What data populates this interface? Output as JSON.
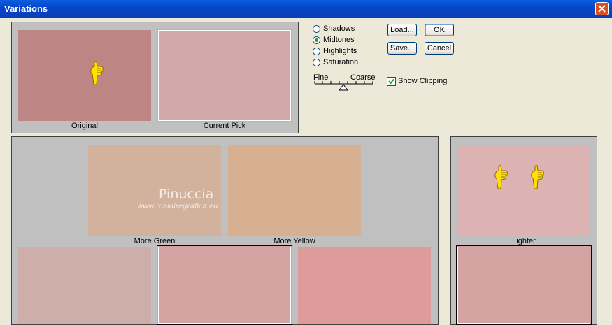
{
  "window": {
    "title": "Variations"
  },
  "preview": {
    "original_label": "Original",
    "current_label": "Current Pick"
  },
  "options": {
    "shadows": "Shadows",
    "midtones": "Midtones",
    "highlights": "Highlights",
    "saturation": "Saturation",
    "selected": "Midtones"
  },
  "slider": {
    "fine": "Fine",
    "coarse": "Coarse"
  },
  "buttons": {
    "load": "Load...",
    "ok": "OK",
    "save": "Save...",
    "cancel": "Cancel"
  },
  "show_clipping": {
    "label": "Show Clipping",
    "checked": true
  },
  "variations": {
    "more_green": "More Green",
    "more_yellow": "More Yellow"
  },
  "brightness": {
    "lighter": "Lighter"
  },
  "watermark": {
    "name": "Pinuccia",
    "site": "www.maidiregrafica.eu"
  },
  "colors": {
    "original": "#bd8685",
    "current": "#d3a8a8",
    "more_green": "#d3b29d",
    "more_yellow": "#d7b091",
    "more_cyan": "#cdaea9",
    "current_pick": "#d5a2a2",
    "more_red": "#df9b9a",
    "lighter": "#dcb2b2",
    "current_right": "#d4a4a3"
  }
}
